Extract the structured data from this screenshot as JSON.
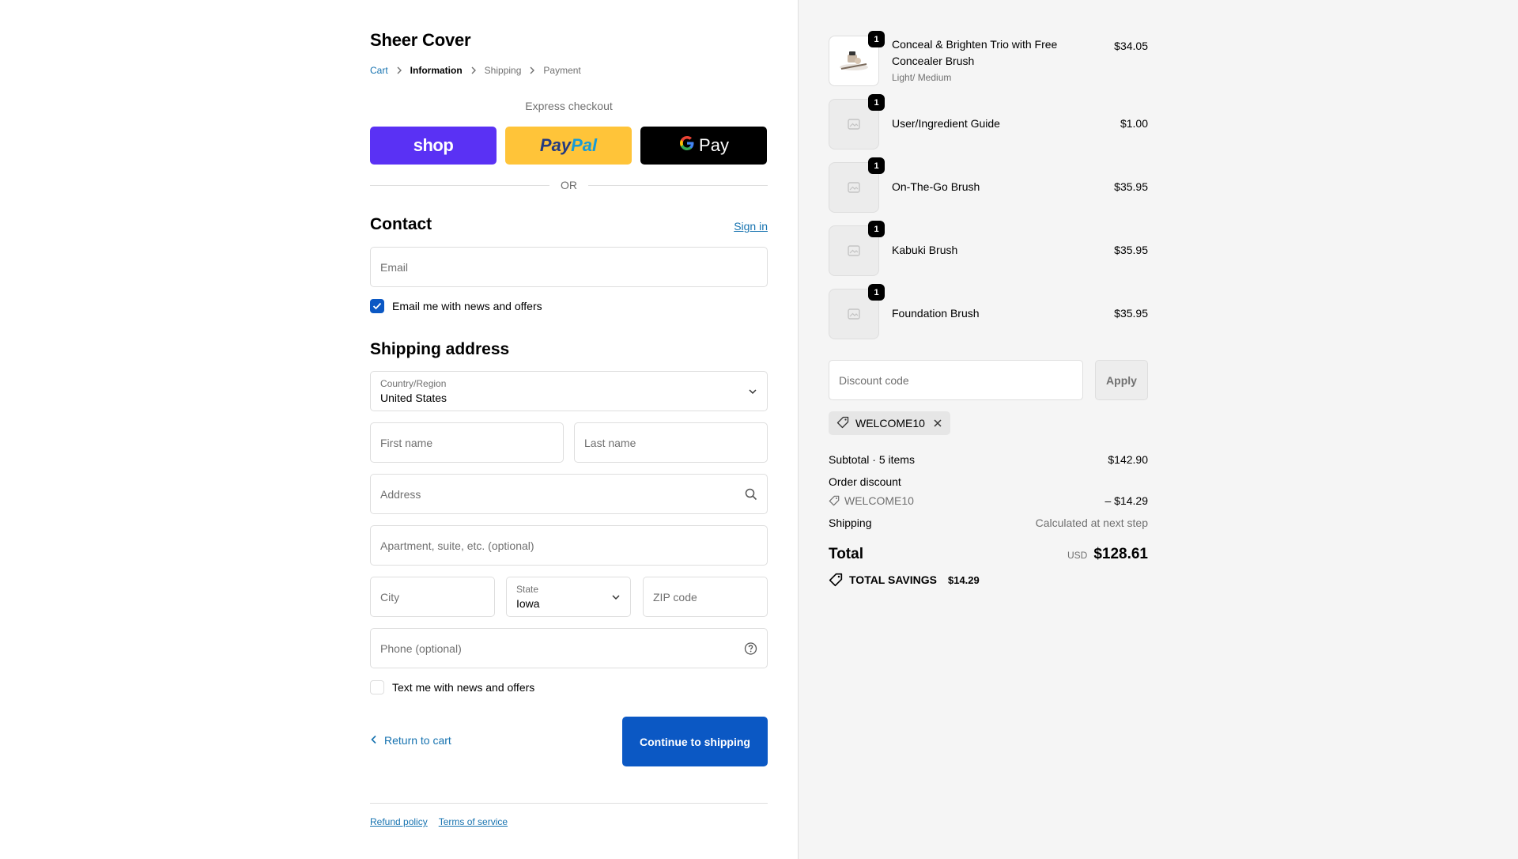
{
  "store": {
    "title": "Sheer Cover"
  },
  "breadcrumb": [
    "Cart",
    "Information",
    "Shipping",
    "Payment"
  ],
  "express": {
    "label": "Express checkout",
    "shop": "shop",
    "paypal_a": "Pay",
    "paypal_b": "Pal",
    "gpay": "Pay",
    "or": "OR"
  },
  "contact": {
    "heading": "Contact",
    "sign_in": "Sign in",
    "email_placeholder": "Email",
    "news_label": "Email me with news and offers",
    "news_checked": true
  },
  "shipping": {
    "heading": "Shipping address",
    "country_label": "Country/Region",
    "country_value": "United States",
    "first_name": "First name",
    "last_name": "Last name",
    "address": "Address",
    "apartment": "Apartment, suite, etc. (optional)",
    "city": "City",
    "state_label": "State",
    "state_value": "Iowa",
    "zip": "ZIP code",
    "phone": "Phone (optional)",
    "text_label": "Text me with news and offers",
    "text_checked": false
  },
  "actions": {
    "return": "Return to cart",
    "continue": "Continue to shipping"
  },
  "footer": {
    "refund": "Refund policy",
    "terms": "Terms of service"
  },
  "order": {
    "items": [
      {
        "name": "Conceal & Brighten Trio with Free Concealer Brush",
        "variant": "Light/ Medium",
        "qty": "1",
        "price": "$34.05",
        "image": "product-photo"
      },
      {
        "name": "User/Ingredient Guide",
        "variant": "",
        "qty": "1",
        "price": "$1.00",
        "image": "placeholder-image-icon"
      },
      {
        "name": "On-The-Go Brush",
        "variant": "",
        "qty": "1",
        "price": "$35.95",
        "image": "placeholder-image-icon"
      },
      {
        "name": "Kabuki Brush",
        "variant": "",
        "qty": "1",
        "price": "$35.95",
        "image": "placeholder-image-icon"
      },
      {
        "name": "Foundation Brush",
        "variant": "",
        "qty": "1",
        "price": "$35.95",
        "image": "placeholder-image-icon"
      }
    ],
    "discount_placeholder": "Discount code",
    "apply": "Apply",
    "applied_code": "WELCOME10",
    "subtotal_label": "Subtotal · 5 items",
    "subtotal": "$142.90",
    "order_discount_label": "Order discount",
    "discount_code": "WELCOME10",
    "discount_amount": "– $14.29",
    "shipping_label": "Shipping",
    "shipping_value": "Calculated at next step",
    "total_label": "Total",
    "currency": "USD",
    "total": "$128.61",
    "savings_label": "TOTAL SAVINGS",
    "savings": "$14.29"
  },
  "colors": {
    "accent": "#0b58c4",
    "link": "#1773b0",
    "shop": "#5a31f4",
    "paypal": "#ffc439"
  }
}
